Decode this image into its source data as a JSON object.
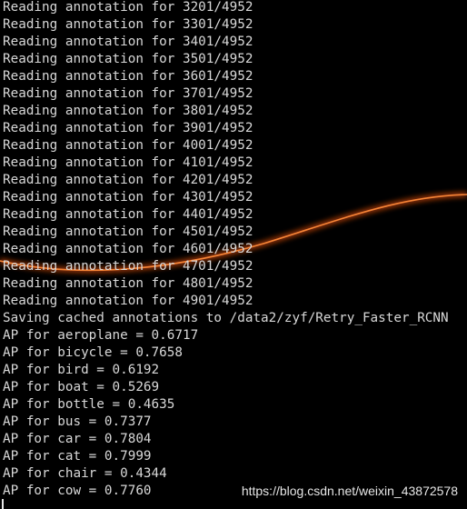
{
  "terminal": {
    "lines": [
      "Reading annotation for 3201/4952",
      "Reading annotation for 3301/4952",
      "Reading annotation for 3401/4952",
      "Reading annotation for 3501/4952",
      "Reading annotation for 3601/4952",
      "Reading annotation for 3701/4952",
      "Reading annotation for 3801/4952",
      "Reading annotation for 3901/4952",
      "Reading annotation for 4001/4952",
      "Reading annotation for 4101/4952",
      "Reading annotation for 4201/4952",
      "Reading annotation for 4301/4952",
      "Reading annotation for 4401/4952",
      "Reading annotation for 4501/4952",
      "Reading annotation for 4601/4952",
      "Reading annotation for 4701/4952",
      "Reading annotation for 4801/4952",
      "Reading annotation for 4901/4952",
      "Saving cached annotations to /data2/zyf/Retry_Faster_RCNN",
      "AP for aeroplane = 0.6717",
      "AP for bicycle = 0.7658",
      "AP for bird = 0.6192",
      "AP for boat = 0.5269",
      "AP for bottle = 0.4635",
      "AP for bus = 0.7377",
      "AP for car = 0.7804",
      "AP for cat = 0.7999",
      "AP for chair = 0.4344",
      "AP for cow = 0.7760"
    ]
  },
  "watermark": "https://blog.csdn.net/weixin_43872578",
  "colors": {
    "background": "#000000",
    "text": "#d8d8d8",
    "glow": "#ff6a1a"
  }
}
